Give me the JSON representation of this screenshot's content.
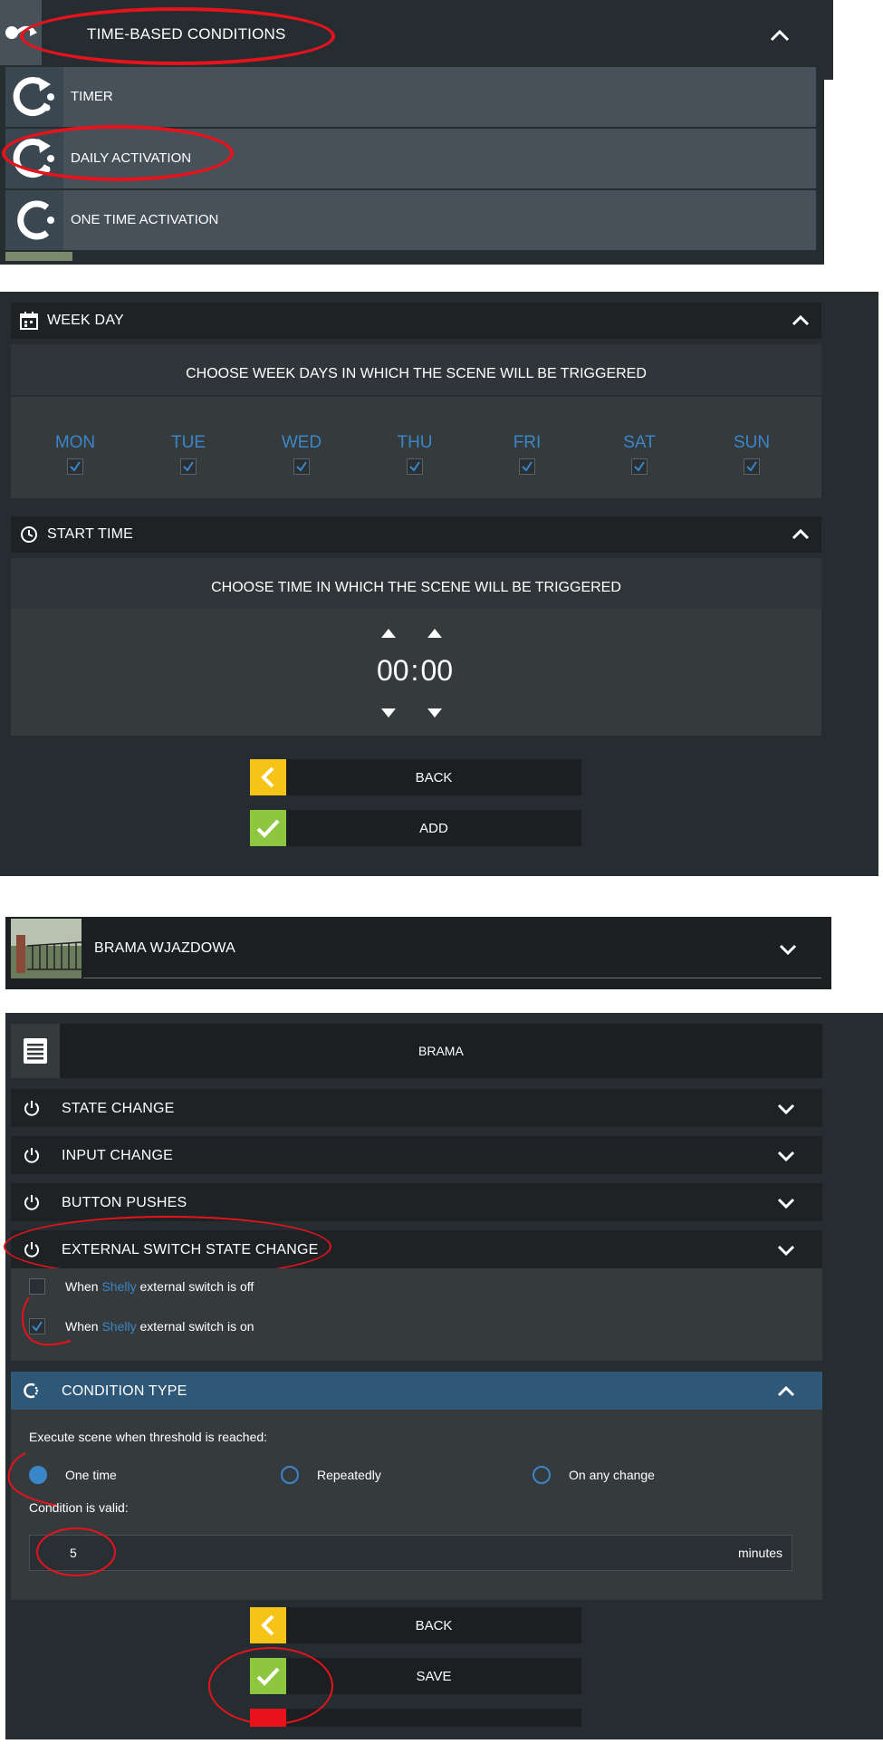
{
  "colors": {
    "panel": "#262d31",
    "row": "#46515a",
    "header": "#1e2224",
    "accent_blue": "#3b86c8",
    "yellow": "#f5c417",
    "green": "#8dc63f",
    "annotation_red": "#e8121c"
  },
  "s1": {
    "header_icon": "curved-arrow-icon",
    "header_label": "TIME-BASED CONDITIONS",
    "items": [
      {
        "icon": "timer-icon",
        "label": "TIMER"
      },
      {
        "icon": "timer-icon",
        "label": "DAILY ACTIVATION"
      },
      {
        "icon": "partial-circle-icon",
        "label": "ONE TIME ACTIVATION"
      }
    ]
  },
  "s2": {
    "weekday_label": "WEEK DAY",
    "weekday_hint": "CHOOSE WEEK DAYS IN WHICH THE SCENE WILL BE TRIGGERED",
    "days": [
      {
        "name": "MON",
        "checked": true
      },
      {
        "name": "TUE",
        "checked": true
      },
      {
        "name": "WED",
        "checked": true
      },
      {
        "name": "THU",
        "checked": true
      },
      {
        "name": "FRI",
        "checked": true
      },
      {
        "name": "SAT",
        "checked": true
      },
      {
        "name": "SUN",
        "checked": true
      }
    ],
    "start_time_label": "START TIME",
    "start_time_hint": "CHOOSE TIME IN WHICH THE SCENE WILL BE TRIGGERED",
    "hours": "00",
    "separator": ":",
    "minutes": "00",
    "back_label": "BACK",
    "add_label": "ADD"
  },
  "s3": {
    "device_name": "BRAMA WJAZDOWA"
  },
  "s4": {
    "device_title": "BRAMA",
    "sections": [
      {
        "label": "STATE CHANGE"
      },
      {
        "label": "INPUT CHANGE"
      },
      {
        "label": "BUTTON PUSHES"
      },
      {
        "label": "EXTERNAL SWITCH STATE CHANGE"
      }
    ],
    "options": [
      {
        "pre": "When ",
        "brand": "Shelly",
        "post": " external switch is off",
        "checked": false
      },
      {
        "pre": "When ",
        "brand": "Shelly",
        "post": " external switch is on",
        "checked": true
      }
    ],
    "condition_type_label": "CONDITION TYPE",
    "execute_label": "Execute scene when threshold is reached:",
    "radios": [
      {
        "label": "One time",
        "selected": true
      },
      {
        "label": "Repeatedly",
        "selected": false
      },
      {
        "label": "On any change",
        "selected": false
      }
    ],
    "valid_label": "Condition is valid:",
    "valid_value": "5",
    "valid_unit": "minutes",
    "back_label": "BACK",
    "save_label": "SAVE"
  }
}
